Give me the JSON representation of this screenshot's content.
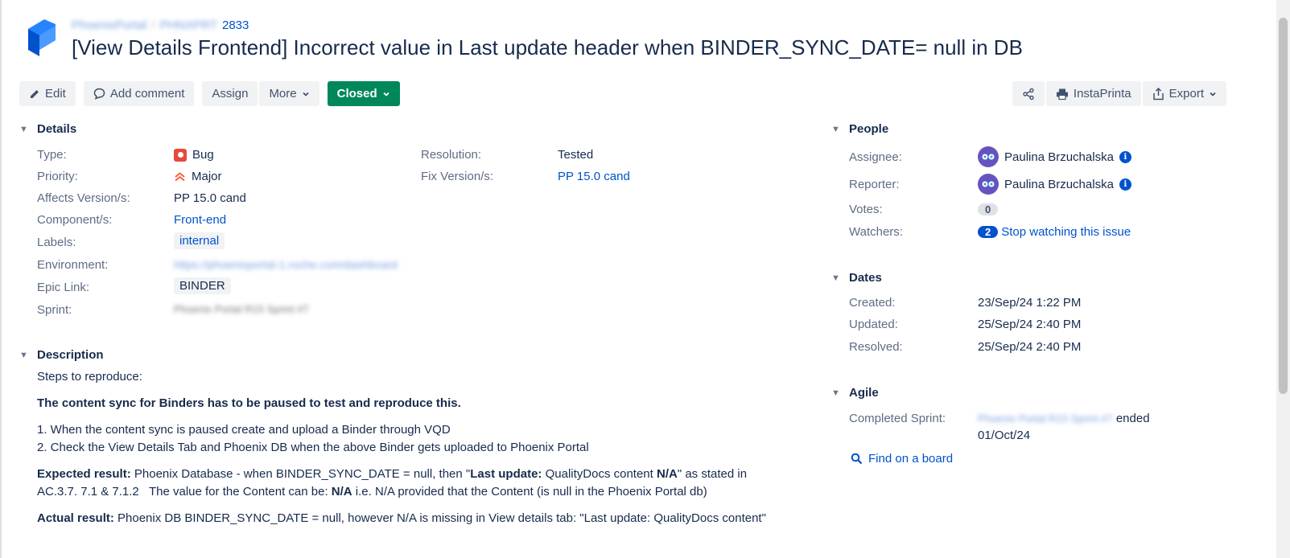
{
  "header": {
    "project": "PhoenixPortal",
    "issue_prefix": "PHNXPRT",
    "issue_number": "2833",
    "title": "[View Details Frontend] Incorrect value in Last update header when BINDER_SYNC_DATE= null in DB"
  },
  "toolbar": {
    "edit": "Edit",
    "add_comment": "Add comment",
    "assign": "Assign",
    "more": "More",
    "status": "Closed",
    "instaprinta": "InstaPrinta",
    "export": "Export"
  },
  "details": {
    "heading": "Details",
    "type_label": "Type:",
    "type_value": "Bug",
    "priority_label": "Priority:",
    "priority_value": "Major",
    "affects_label": "Affects Version/s:",
    "affects_value": "PP 15.0 cand",
    "component_label": "Component/s:",
    "component_value": "Front-end",
    "labels_label": "Labels:",
    "labels_value": "internal",
    "environment_label": "Environment:",
    "environment_value": "https://phoenixportal-1.roche.com/dashboard",
    "epic_label": "Epic Link:",
    "epic_value": "BINDER",
    "sprint_label": "Sprint:",
    "sprint_value": "Phoenix Portal R15 Sprint #7",
    "resolution_label": "Resolution:",
    "resolution_value": "Tested",
    "fix_label": "Fix Version/s:",
    "fix_value": "PP 15.0 cand"
  },
  "description": {
    "heading": "Description",
    "steps_intro": "Steps to reproduce:",
    "bold_note": "The content sync for Binders has to be paused to test and reproduce this.",
    "step1": "1. When the content sync is paused create and upload a Binder through VQD",
    "step2": "2. Check the View Details Tab and Phoenix DB when the above Binder gets uploaded to Phoenix Portal",
    "expected_label": "Expected result:",
    "expected_text_1": " Phoenix Database - when BINDER_SYNC_DATE = null, then \"",
    "expected_bold_1": "Last update:",
    "expected_text_2": " QualityDocs content ",
    "expected_bold_2": "N/A",
    "expected_text_3": "\" as stated in",
    "expected_line2_a": "AC.3.7. 7.1 & 7.1.2   The value for the Content can be: ",
    "expected_line2_bold": "N/A",
    "expected_line2_b": " i.e. N/A provided that the Content (is null in the Phoenix Portal db)",
    "actual_label": "Actual result:",
    "actual_text": " Phoenix DB BINDER_SYNC_DATE = null, however N/A is missing in View details tab: \"Last update: QualityDocs content\""
  },
  "people": {
    "heading": "People",
    "assignee_label": "Assignee:",
    "assignee_value": "Paulina Brzuchalska",
    "reporter_label": "Reporter:",
    "reporter_value": "Paulina Brzuchalska",
    "votes_label": "Votes:",
    "votes_value": "0",
    "watchers_label": "Watchers:",
    "watchers_count": "2",
    "watchers_link": "Stop watching this issue"
  },
  "dates": {
    "heading": "Dates",
    "created_label": "Created:",
    "created_value": "23/Sep/24 1:22 PM",
    "updated_label": "Updated:",
    "updated_value": "25/Sep/24 2:40 PM",
    "resolved_label": "Resolved:",
    "resolved_value": "25/Sep/24 2:40 PM"
  },
  "agile": {
    "heading": "Agile",
    "completed_label": "Completed Sprint:",
    "completed_sprint": "Phoenix Portal R15 Sprint #7",
    "ended_text": "ended",
    "ended_date": "01/Oct/24",
    "find_board": "Find on a board"
  }
}
